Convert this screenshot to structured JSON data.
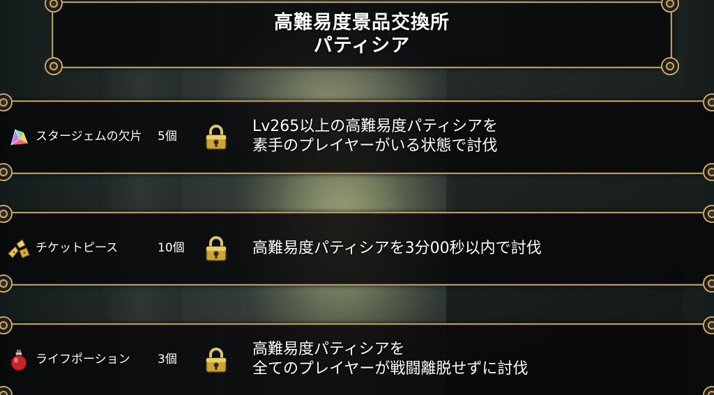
{
  "header": {
    "title_line1": "高難易度景品交換所",
    "title_line2": "パティシア"
  },
  "rewards": [
    {
      "icon": "star-gem-shard-icon",
      "name": "スタージェムの欠片",
      "count": "5個",
      "locked": true,
      "condition_line1": "Lv265以上の高難易度パティシアを",
      "condition_line2": "素手のプレイヤーがいる状態で討伐"
    },
    {
      "icon": "ticket-piece-icon",
      "name": "チケットピース",
      "count": "10個",
      "locked": true,
      "condition_line1": "高難易度パティシアを3分00秒以内で討伐",
      "condition_line2": ""
    },
    {
      "icon": "life-potion-icon",
      "name": "ライフポーション",
      "count": "3個",
      "locked": true,
      "condition_line1": "高難易度パティシアを",
      "condition_line2": "全てのプレイヤーが戦闘離脱せずに討伐"
    }
  ],
  "colors": {
    "frame_gold": "#b39a6c",
    "text": "#ffffff",
    "panel": "#08080a"
  }
}
